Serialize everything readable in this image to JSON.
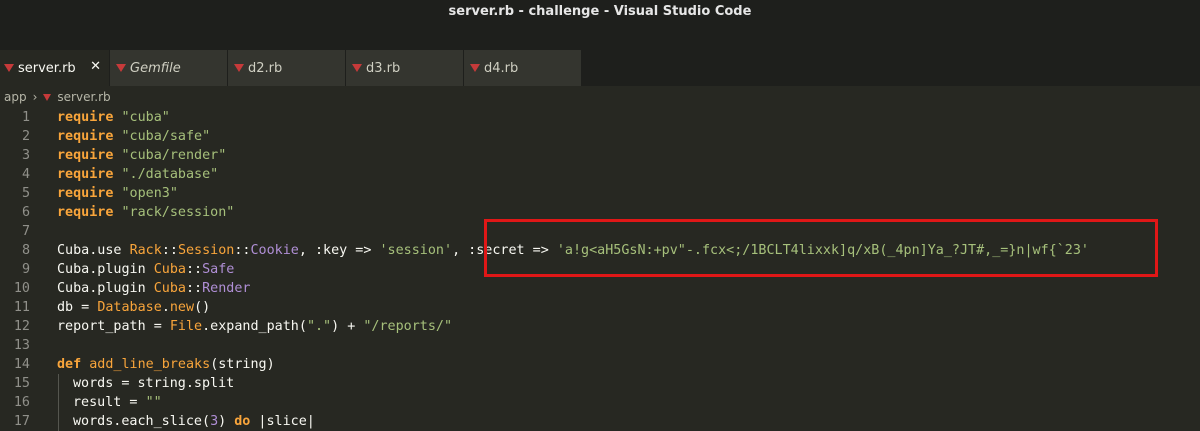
{
  "window": {
    "title": "server.rb - challenge - Visual Studio Code"
  },
  "tabs": [
    {
      "label": "server.rb",
      "active": true,
      "italic": false
    },
    {
      "label": "Gemfile",
      "active": false,
      "italic": true
    },
    {
      "label": "d2.rb",
      "active": false,
      "italic": false
    },
    {
      "label": "d3.rb",
      "active": false,
      "italic": false
    },
    {
      "label": "d4.rb",
      "active": false,
      "italic": false
    }
  ],
  "breadcrumb": {
    "folder": "app",
    "file": "server.rb"
  },
  "colors": {
    "background": "#272822",
    "keyword": "#f9a53b",
    "string": "#a6c07b",
    "constant": "#b08fd6",
    "highlight_box": "#e01717",
    "ruby_icon": "#c63a3a"
  },
  "editor": {
    "lines": [
      {
        "n": "1",
        "tokens": [
          [
            "kw",
            "require"
          ],
          [
            "",
            " "
          ],
          [
            "str",
            "\"cuba\""
          ]
        ]
      },
      {
        "n": "2",
        "tokens": [
          [
            "kw",
            "require"
          ],
          [
            "",
            " "
          ],
          [
            "str",
            "\"cuba/safe\""
          ]
        ]
      },
      {
        "n": "3",
        "tokens": [
          [
            "kw",
            "require"
          ],
          [
            "",
            " "
          ],
          [
            "str",
            "\"cuba/render\""
          ]
        ]
      },
      {
        "n": "4",
        "tokens": [
          [
            "kw",
            "require"
          ],
          [
            "",
            " "
          ],
          [
            "str",
            "\"./database\""
          ]
        ]
      },
      {
        "n": "5",
        "tokens": [
          [
            "kw",
            "require"
          ],
          [
            "",
            " "
          ],
          [
            "str",
            "\"open3\""
          ]
        ]
      },
      {
        "n": "6",
        "tokens": [
          [
            "kw",
            "require"
          ],
          [
            "",
            " "
          ],
          [
            "str",
            "\"rack/session\""
          ]
        ]
      },
      {
        "n": "7",
        "tokens": []
      },
      {
        "n": "8",
        "tokens": [
          [
            "",
            "Cuba.use "
          ],
          [
            "cls",
            "Rack"
          ],
          [
            "",
            "::"
          ],
          [
            "cls",
            "Session"
          ],
          [
            "",
            "::"
          ],
          [
            "const",
            "Cookie"
          ],
          [
            "",
            ", :key => "
          ],
          [
            "str",
            "'session'"
          ],
          [
            "",
            ", :secret => "
          ],
          [
            "str",
            "'a!g<aH5GsN:+pv\"-.fcx<;/1BCLT4lixxk]q/xB(_4pn]Ya_?JT#,_=}n|wf{`23'"
          ]
        ]
      },
      {
        "n": "9",
        "tokens": [
          [
            "",
            "Cuba.plugin "
          ],
          [
            "cls",
            "Cuba"
          ],
          [
            "",
            "::"
          ],
          [
            "const",
            "Safe"
          ]
        ]
      },
      {
        "n": "10",
        "tokens": [
          [
            "",
            "Cuba.plugin "
          ],
          [
            "cls",
            "Cuba"
          ],
          [
            "",
            "::"
          ],
          [
            "const",
            "Render"
          ]
        ]
      },
      {
        "n": "11",
        "tokens": [
          [
            "",
            "db = "
          ],
          [
            "cls",
            "Database"
          ],
          [
            "",
            "."
          ],
          [
            "fn",
            "new"
          ],
          [
            "",
            "()"
          ]
        ]
      },
      {
        "n": "12",
        "tokens": [
          [
            "",
            "report_path = "
          ],
          [
            "cls",
            "File"
          ],
          [
            "",
            ".expand_path("
          ],
          [
            "str",
            "\".\""
          ],
          [
            "",
            ") + "
          ],
          [
            "str",
            "\"/reports/\""
          ]
        ]
      },
      {
        "n": "13",
        "tokens": []
      },
      {
        "n": "14",
        "tokens": [
          [
            "kw",
            "def"
          ],
          [
            "",
            " "
          ],
          [
            "fn",
            "add_line_breaks"
          ],
          [
            "",
            "(string)"
          ]
        ]
      },
      {
        "n": "15",
        "indent": true,
        "tokens": [
          [
            "",
            "words = string.split"
          ]
        ]
      },
      {
        "n": "16",
        "indent": true,
        "tokens": [
          [
            "",
            "result = "
          ],
          [
            "str",
            "\"\""
          ]
        ]
      },
      {
        "n": "17",
        "indent": true,
        "tokens": [
          [
            "",
            "words.each_slice("
          ],
          [
            "const",
            "3"
          ],
          [
            "",
            ") "
          ],
          [
            "kw",
            "do"
          ],
          [
            "",
            " |slice|"
          ]
        ]
      }
    ]
  }
}
